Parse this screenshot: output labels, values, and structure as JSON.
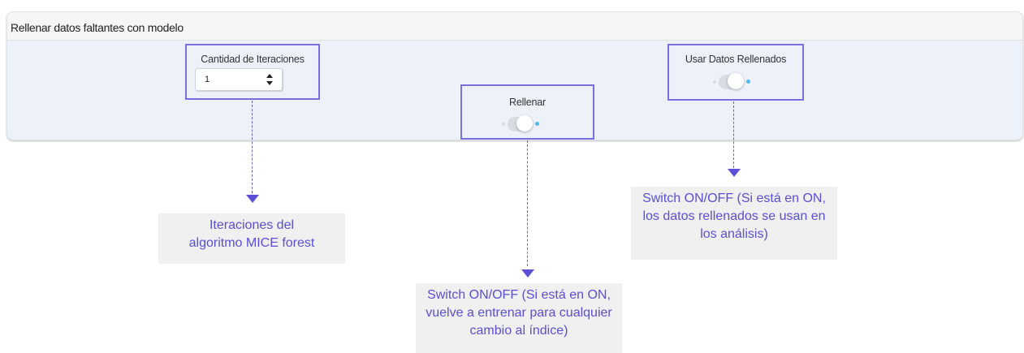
{
  "panel": {
    "title": "Rellenar datos faltantes con modelo"
  },
  "iterations": {
    "label": "Cantidad de Iteraciones",
    "value": "1"
  },
  "fill": {
    "label": "Rellenar",
    "state": "off"
  },
  "use_filled": {
    "label": "Usar Datos Rellenados",
    "state": "off"
  },
  "annotations": {
    "iterations_note": "Iteraciones del algoritmo MICE forest",
    "fill_note": "Switch ON/OFF (Si está en ON, vuelve a entrenar para cualquier cambio al índice)",
    "use_filled_note": "Switch ON/OFF (Si está en ON, los datos rellenados se usan en los análisis)"
  },
  "colors": {
    "accent": "#6b5fd9",
    "note_text": "#5a4fd4",
    "note_bg": "#f0f0f0",
    "toggle_dot": "#4bb9ea"
  }
}
